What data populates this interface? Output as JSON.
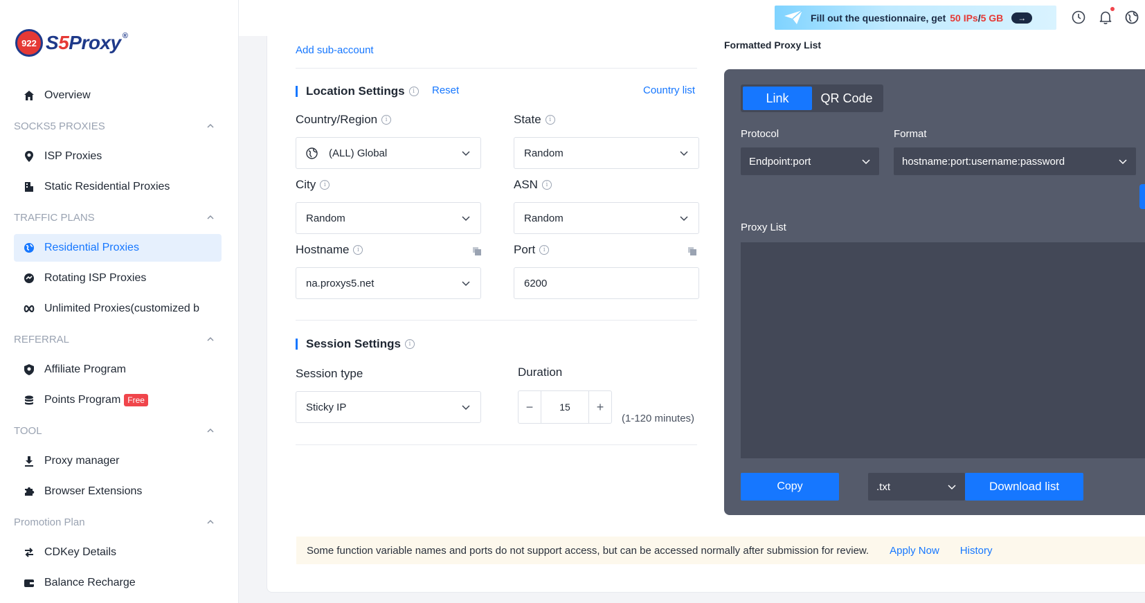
{
  "brand": {
    "badge": "922",
    "name_a": "S",
    "name_b": "5",
    "name_c": "Proxy",
    "reg": "®"
  },
  "sidebar": {
    "overview": "Overview",
    "groups": [
      {
        "title": "SOCKS5 PROXIES",
        "items": [
          "ISP Proxies",
          "Static Residential Proxies"
        ]
      },
      {
        "title": "TRAFFIC PLANS",
        "items": [
          "Residential Proxies",
          "Rotating ISP Proxies",
          "Unlimited Proxies(customized b"
        ]
      },
      {
        "title": "REFERRAL",
        "items": [
          "Affiliate Program",
          "Points Program"
        ]
      },
      {
        "title": "TOOL",
        "items": [
          "Proxy manager",
          "Browser Extensions"
        ]
      },
      {
        "title": "Promotion Plan",
        "items": [
          "CDKey Details",
          "Balance Recharge"
        ]
      }
    ],
    "free_badge": "Free",
    "active_item": "Residential Proxies"
  },
  "topbar": {
    "promo_text": "Fill out the questionnaire, get",
    "promo_highlight_a": "50 IPs",
    "promo_sep": " / ",
    "promo_highlight_b": "5 GB",
    "promo_arrow": "→"
  },
  "main": {
    "add_sub_account": "Add sub-account",
    "location": {
      "title": "Location Settings",
      "reset": "Reset",
      "country_list": "Country list",
      "country_label": "Country/Region",
      "country_value": "(ALL)  Global",
      "state_label": "State",
      "state_value": "Random",
      "city_label": "City",
      "city_value": "Random",
      "asn_label": "ASN",
      "asn_value": "Random",
      "hostname_label": "Hostname",
      "hostname_value": "na.proxys5.net",
      "port_label": "Port",
      "port_value": "6200"
    },
    "session": {
      "title": "Session Settings",
      "type_label": "Session type",
      "type_value": "Sticky IP",
      "duration_label": "Duration",
      "duration_value": "15",
      "duration_minus": "−",
      "duration_plus": "+",
      "duration_hint": "(1-120 minutes)"
    },
    "notice": {
      "text": "Some function variable names and ports do not support access, but can be accessed normally after submission for review.",
      "apply": "Apply Now",
      "history": "History"
    }
  },
  "proxy_panel": {
    "heading": "Formatted Proxy List",
    "tab_link": "Link",
    "tab_qr": "QR Code",
    "protocol_label": "Protocol",
    "protocol_value": "Endpoint:port",
    "format_label": "Format",
    "format_value": "hostname:port:username:password",
    "list_label": "Proxy List",
    "copy": "Copy",
    "ext_value": ".txt",
    "download": "Download list"
  },
  "colors": {
    "accent": "#1677ff",
    "panel": "#555b6b",
    "panel_dark": "#434857",
    "danger": "#f0454b"
  }
}
